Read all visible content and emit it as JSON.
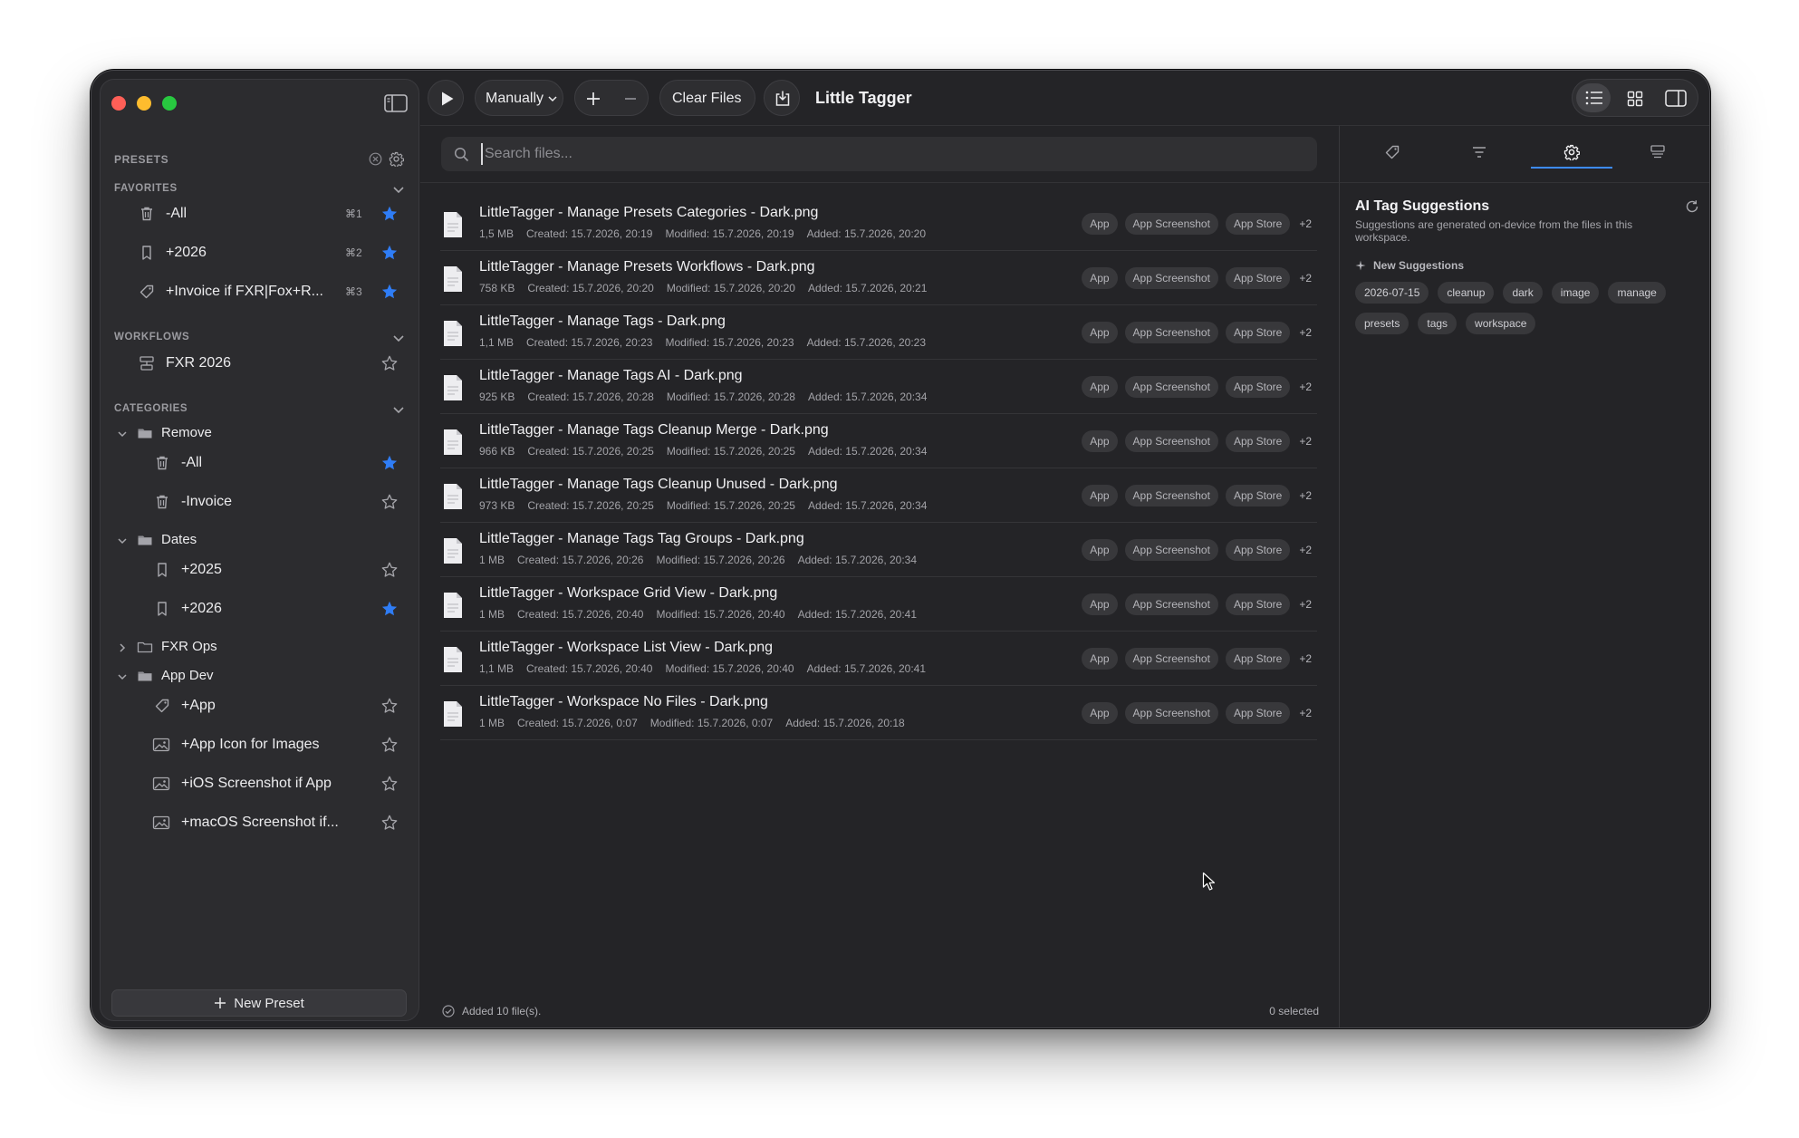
{
  "app": {
    "title": "Little Tagger"
  },
  "toolbar": {
    "run_label": "play",
    "mode_label": "Manually",
    "clear_label": "Clear Files",
    "add_label": "+",
    "remove_label": "−"
  },
  "sidebar": {
    "presets_header": "PRESETS",
    "favorites_header": "FAVORITES",
    "workflows_header": "WORKFLOWS",
    "categories_header": "CATEGORIES",
    "favorites": [
      {
        "icon": "trash-icon",
        "label": "-All",
        "shortcut": "⌘1",
        "starred": true
      },
      {
        "icon": "bookmark-icon",
        "label": "+2026",
        "shortcut": "⌘2",
        "starred": true
      },
      {
        "icon": "tag-icon",
        "label": "+Invoice if FXR|Fox+R...",
        "shortcut": "⌘3",
        "starred": true
      }
    ],
    "workflows": [
      {
        "icon": "workflow-icon",
        "label": "FXR 2026",
        "starred": false
      }
    ],
    "categories": [
      {
        "name": "Remove",
        "expanded": true
      },
      {
        "name": "Dates",
        "expanded": true
      },
      {
        "name": "FXR Ops",
        "expanded": false
      },
      {
        "name": "App Dev",
        "expanded": true
      }
    ],
    "remove_items": [
      {
        "icon": "trash-icon",
        "label": "-All",
        "starred": true
      },
      {
        "icon": "trash-icon",
        "label": "-Invoice",
        "starred": false
      }
    ],
    "dates_items": [
      {
        "icon": "bookmark-icon",
        "label": "+2025",
        "starred": false
      },
      {
        "icon": "bookmark-icon",
        "label": "+2026",
        "starred": true
      }
    ],
    "appdev_items": [
      {
        "icon": "tag-icon",
        "label": "+App",
        "starred": false
      },
      {
        "icon": "image-icon",
        "label": "+App Icon for Images",
        "starred": false
      },
      {
        "icon": "image-icon",
        "label": "+iOS Screenshot if App",
        "starred": false
      },
      {
        "icon": "image-icon",
        "label": "+macOS Screenshot if...",
        "starred": false
      }
    ],
    "new_preset_label": "New Preset"
  },
  "search": {
    "placeholder": "Search files..."
  },
  "files": [
    {
      "name": "LittleTagger - Manage Presets Categories - Dark.png",
      "size": "1,5 MB",
      "created": "Created: 15.7.2026, 20:19",
      "modified": "Modified: 15.7.2026, 20:19",
      "added": "Added: 15.7.2026, 20:20",
      "tags": [
        "App",
        "App Screenshot",
        "App Store"
      ],
      "more": "+2"
    },
    {
      "name": "LittleTagger - Manage Presets Workflows - Dark.png",
      "size": "758 KB",
      "created": "Created: 15.7.2026, 20:20",
      "modified": "Modified: 15.7.2026, 20:20",
      "added": "Added: 15.7.2026, 20:21",
      "tags": [
        "App",
        "App Screenshot",
        "App Store"
      ],
      "more": "+2"
    },
    {
      "name": "LittleTagger - Manage Tags - Dark.png",
      "size": "1,1 MB",
      "created": "Created: 15.7.2026, 20:23",
      "modified": "Modified: 15.7.2026, 20:23",
      "added": "Added: 15.7.2026, 20:23",
      "tags": [
        "App",
        "App Screenshot",
        "App Store"
      ],
      "more": "+2"
    },
    {
      "name": "LittleTagger - Manage Tags AI - Dark.png",
      "size": "925 KB",
      "created": "Created: 15.7.2026, 20:28",
      "modified": "Modified: 15.7.2026, 20:28",
      "added": "Added: 15.7.2026, 20:34",
      "tags": [
        "App",
        "App Screenshot",
        "App Store"
      ],
      "more": "+2"
    },
    {
      "name": "LittleTagger - Manage Tags Cleanup Merge - Dark.png",
      "size": "966 KB",
      "created": "Created: 15.7.2026, 20:25",
      "modified": "Modified: 15.7.2026, 20:25",
      "added": "Added: 15.7.2026, 20:34",
      "tags": [
        "App",
        "App Screenshot",
        "App Store"
      ],
      "more": "+2"
    },
    {
      "name": "LittleTagger - Manage Tags Cleanup Unused - Dark.png",
      "size": "973 KB",
      "created": "Created: 15.7.2026, 20:25",
      "modified": "Modified: 15.7.2026, 20:25",
      "added": "Added: 15.7.2026, 20:34",
      "tags": [
        "App",
        "App Screenshot",
        "App Store"
      ],
      "more": "+2"
    },
    {
      "name": "LittleTagger - Manage Tags Tag Groups - Dark.png",
      "size": "1 MB",
      "created": "Created: 15.7.2026, 20:26",
      "modified": "Modified: 15.7.2026, 20:26",
      "added": "Added: 15.7.2026, 20:34",
      "tags": [
        "App",
        "App Screenshot",
        "App Store"
      ],
      "more": "+2"
    },
    {
      "name": "LittleTagger - Workspace Grid View - Dark.png",
      "size": "1 MB",
      "created": "Created: 15.7.2026, 20:40",
      "modified": "Modified: 15.7.2026, 20:40",
      "added": "Added: 15.7.2026, 20:41",
      "tags": [
        "App",
        "App Screenshot",
        "App Store"
      ],
      "more": "+2"
    },
    {
      "name": "LittleTagger - Workspace List View - Dark.png",
      "size": "1,1 MB",
      "created": "Created: 15.7.2026, 20:40",
      "modified": "Modified: 15.7.2026, 20:40",
      "added": "Added: 15.7.2026, 20:41",
      "tags": [
        "App",
        "App Screenshot",
        "App Store"
      ],
      "more": "+2"
    },
    {
      "name": "LittleTagger - Workspace No Files - Dark.png",
      "size": "1 MB",
      "created": "Created: 15.7.2026, 0:07",
      "modified": "Modified: 15.7.2026, 0:07",
      "added": "Added: 15.7.2026, 20:18",
      "tags": [
        "App",
        "App Screenshot",
        "App Store"
      ],
      "more": "+2"
    }
  ],
  "status": {
    "left": "Added 10 file(s).",
    "right": "0 selected"
  },
  "inspector": {
    "tabs": [
      "tag-icon",
      "filter-icon",
      "gear-icon",
      "stack-icon"
    ],
    "active_tab": 2,
    "title": "AI Tag Suggestions",
    "subtitle": "Suggestions are generated on-device from the files in this workspace.",
    "new_suggestions_label": "New Suggestions",
    "suggestions": [
      "2026-07-15",
      "cleanup",
      "dark",
      "image",
      "manage",
      "presets",
      "tags",
      "workspace"
    ]
  },
  "colors": {
    "accent": "#3d8bff",
    "star": "#2f7df6",
    "window_bg": "#242427",
    "sidebar_bg": "#2c2c2f"
  }
}
